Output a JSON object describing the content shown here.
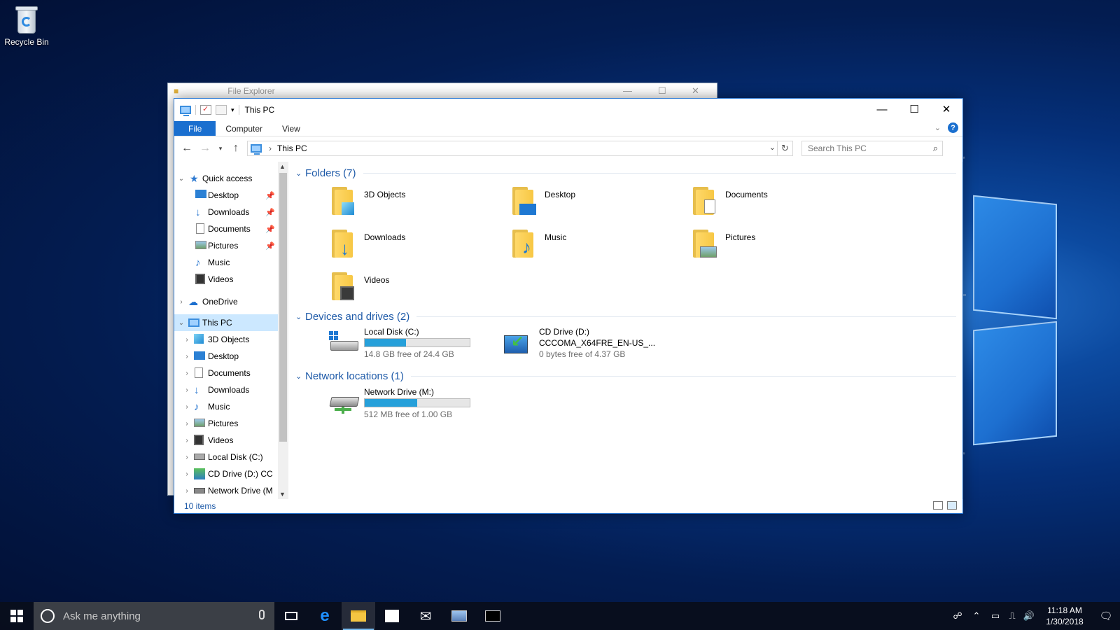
{
  "desktop": {
    "recycle_bin_label": "Recycle Bin"
  },
  "background_window": {
    "title": "File Explorer"
  },
  "window": {
    "title": "This PC",
    "ribbon_tabs": [
      "File",
      "Computer",
      "View"
    ],
    "address": "This PC",
    "search_placeholder": "Search This PC",
    "status": "10 items"
  },
  "nav_pane": {
    "quick_access": "Quick access",
    "quick_items": [
      "Desktop",
      "Downloads",
      "Documents",
      "Pictures",
      "Music",
      "Videos"
    ],
    "onedrive": "OneDrive",
    "this_pc": "This PC",
    "pc_items": [
      "3D Objects",
      "Desktop",
      "Documents",
      "Downloads",
      "Music",
      "Pictures",
      "Videos",
      "Local Disk (C:)",
      "CD Drive (D:) CC",
      "Network Drive (M"
    ]
  },
  "content": {
    "folders_header": "Folders (7)",
    "folders": [
      "3D Objects",
      "Desktop",
      "Documents",
      "Downloads",
      "Music",
      "Pictures",
      "Videos"
    ],
    "devices_header": "Devices and drives (2)",
    "local_disk": {
      "name": "Local Disk (C:)",
      "free": "14.8 GB free of 24.4 GB",
      "used_fraction": 0.39
    },
    "cd_drive": {
      "name": "CD Drive (D:)",
      "label": "CCCOMA_X64FRE_EN-US_...",
      "free": "0 bytes free of 4.37 GB"
    },
    "network_header": "Network locations (1)",
    "network_drive": {
      "name": "Network Drive (M:)",
      "free": "512 MB free of 1.00 GB",
      "used_fraction": 0.5
    }
  },
  "taskbar": {
    "search_placeholder": "Ask me anything",
    "time": "11:18 AM",
    "date": "1/30/2018"
  },
  "colors": {
    "accent": "#1a6fcf",
    "selection": "#cce8ff",
    "group_header": "#1e5aa8",
    "drive_bar": "#26a0da"
  }
}
